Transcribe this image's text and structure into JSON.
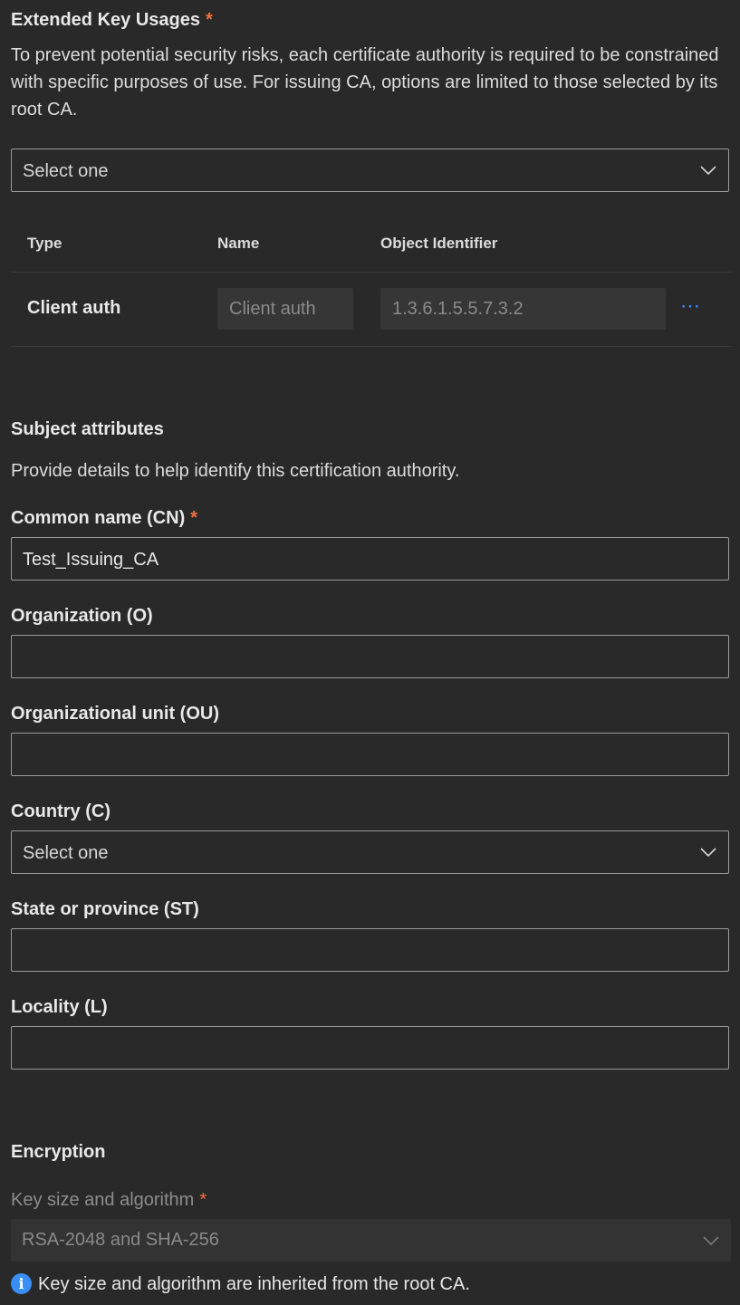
{
  "eku": {
    "title": "Extended Key Usages",
    "required_mark": "*",
    "description": "To prevent potential security risks, each certificate authority is required to be constrained with specific purposes of use. For issuing CA, options are limited to those selected by its root CA.",
    "select_placeholder": "Select one",
    "table": {
      "headers": {
        "type": "Type",
        "name": "Name",
        "oid": "Object Identifier"
      },
      "rows": [
        {
          "type": "Client auth",
          "name": "Client auth",
          "oid": "1.3.6.1.5.5.7.3.2",
          "more": "⋯"
        }
      ]
    }
  },
  "subject": {
    "title": "Subject attributes",
    "description": "Provide details to help identify this certification authority.",
    "fields": {
      "cn": {
        "label": "Common name (CN)",
        "required_mark": "*",
        "value": "Test_Issuing_CA"
      },
      "o": {
        "label": "Organization (O)",
        "value": ""
      },
      "ou": {
        "label": "Organizational unit (OU)",
        "value": ""
      },
      "c": {
        "label": "Country (C)",
        "value": "Select one"
      },
      "st": {
        "label": "State or province (ST)",
        "value": ""
      },
      "l": {
        "label": "Locality (L)",
        "value": ""
      }
    }
  },
  "encryption": {
    "title": "Encryption",
    "key_label": "Key size and algorithm",
    "required_mark": "*",
    "key_value": "RSA-2048 and SHA-256",
    "info_icon": "i",
    "info_text": "Key size and algorithm are inherited from the root CA."
  },
  "colors": {
    "accent": "#3a8ff7",
    "required": "#f1703f",
    "background": "#292929"
  }
}
